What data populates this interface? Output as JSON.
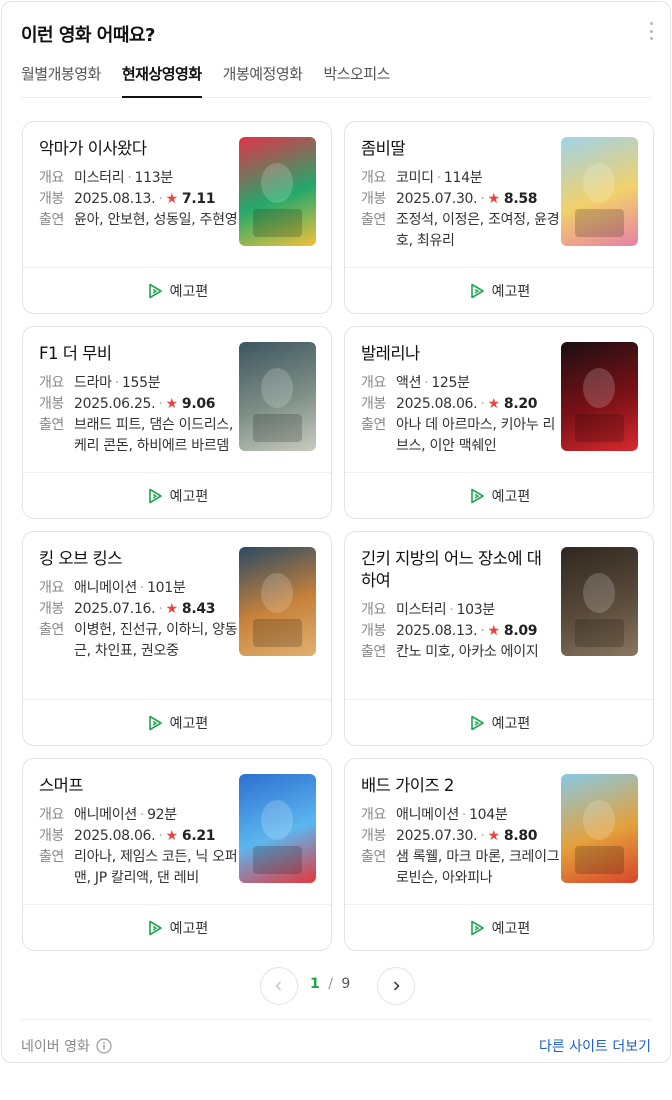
{
  "header": {
    "title": "이런 영화 어때요?"
  },
  "tabs": [
    {
      "label": "월별개봉영화",
      "active": false
    },
    {
      "label": "현재상영영화",
      "active": true
    },
    {
      "label": "개봉예정영화",
      "active": false
    },
    {
      "label": "박스오피스",
      "active": false
    }
  ],
  "labels": {
    "genre": "개요",
    "release": "개봉",
    "cast": "출연",
    "trailer": "예고편"
  },
  "movies": [
    {
      "title": "악마가 이사왔다",
      "genre": "미스터리",
      "runtime": "113분",
      "date": "2025.08.13.",
      "rating": "7.11",
      "cast": "윤아, 안보현, 성동일, 주현영",
      "poster_colors": [
        "#e3324a",
        "#23a86b",
        "#f2c13a"
      ]
    },
    {
      "title": "좀비딸",
      "genre": "코미디",
      "runtime": "114분",
      "date": "2025.07.30.",
      "rating": "8.58",
      "cast": "조정석, 이정은, 조여정, 윤경호, 최유리",
      "poster_colors": [
        "#9fd3ea",
        "#f1d16a",
        "#e87fa5"
      ]
    },
    {
      "title": "F1 더 무비",
      "genre": "드라마",
      "runtime": "155분",
      "date": "2025.06.25.",
      "rating": "9.06",
      "cast": "브래드 피트, 댐슨 이드리스, 케리 콘돈, 하비에르 바르뎀",
      "poster_colors": [
        "#3e5560",
        "#7d8f86",
        "#c9cbbf"
      ]
    },
    {
      "title": "발레리나",
      "genre": "액션",
      "runtime": "125분",
      "date": "2025.08.06.",
      "rating": "8.20",
      "cast": "아나 데 아르마스, 키아누 리브스, 이안 맥쉐인",
      "poster_colors": [
        "#1a0f12",
        "#7a1016",
        "#d82a2e"
      ]
    },
    {
      "title": "킹 오브 킹스",
      "genre": "애니메이션",
      "runtime": "101분",
      "date": "2025.07.16.",
      "rating": "8.43",
      "cast": "이병헌, 진선규, 이하늬, 양동근, 차인표, 권오중",
      "poster_colors": [
        "#2b4a64",
        "#c7823a",
        "#e2b070"
      ]
    },
    {
      "title": "긴키 지방의 어느 장소에 대하여",
      "genre": "미스터리",
      "runtime": "103분",
      "date": "2025.08.13.",
      "rating": "8.09",
      "cast": "칸노 미호, 아카소 에이지",
      "poster_colors": [
        "#2e2720",
        "#5a4a3a",
        "#8a7660"
      ]
    },
    {
      "title": "스머프",
      "genre": "애니메이션",
      "runtime": "92분",
      "date": "2025.08.06.",
      "rating": "6.21",
      "cast": "리아나, 제임스 코든, 닉 오퍼맨, JP 칼리액, 댄 레비",
      "poster_colors": [
        "#2e6fd0",
        "#5bb6ef",
        "#e6373a"
      ]
    },
    {
      "title": "배드 가이즈 2",
      "genre": "애니메이션",
      "runtime": "104분",
      "date": "2025.07.30.",
      "rating": "8.80",
      "cast": "샘 록웰, 마크 마론, 크레이그 로빈슨, 아와피나",
      "poster_colors": [
        "#87c9e6",
        "#e3a13b",
        "#d8452c"
      ]
    }
  ],
  "pagination": {
    "current": "1",
    "separator": "/",
    "total": "9"
  },
  "footer": {
    "source": "네이버 영화",
    "more_link": "다른 사이트 더보기"
  },
  "colors": {
    "accent_green": "#1ea651",
    "star_red": "#e8463c",
    "link_blue": "#1b5fc9"
  }
}
